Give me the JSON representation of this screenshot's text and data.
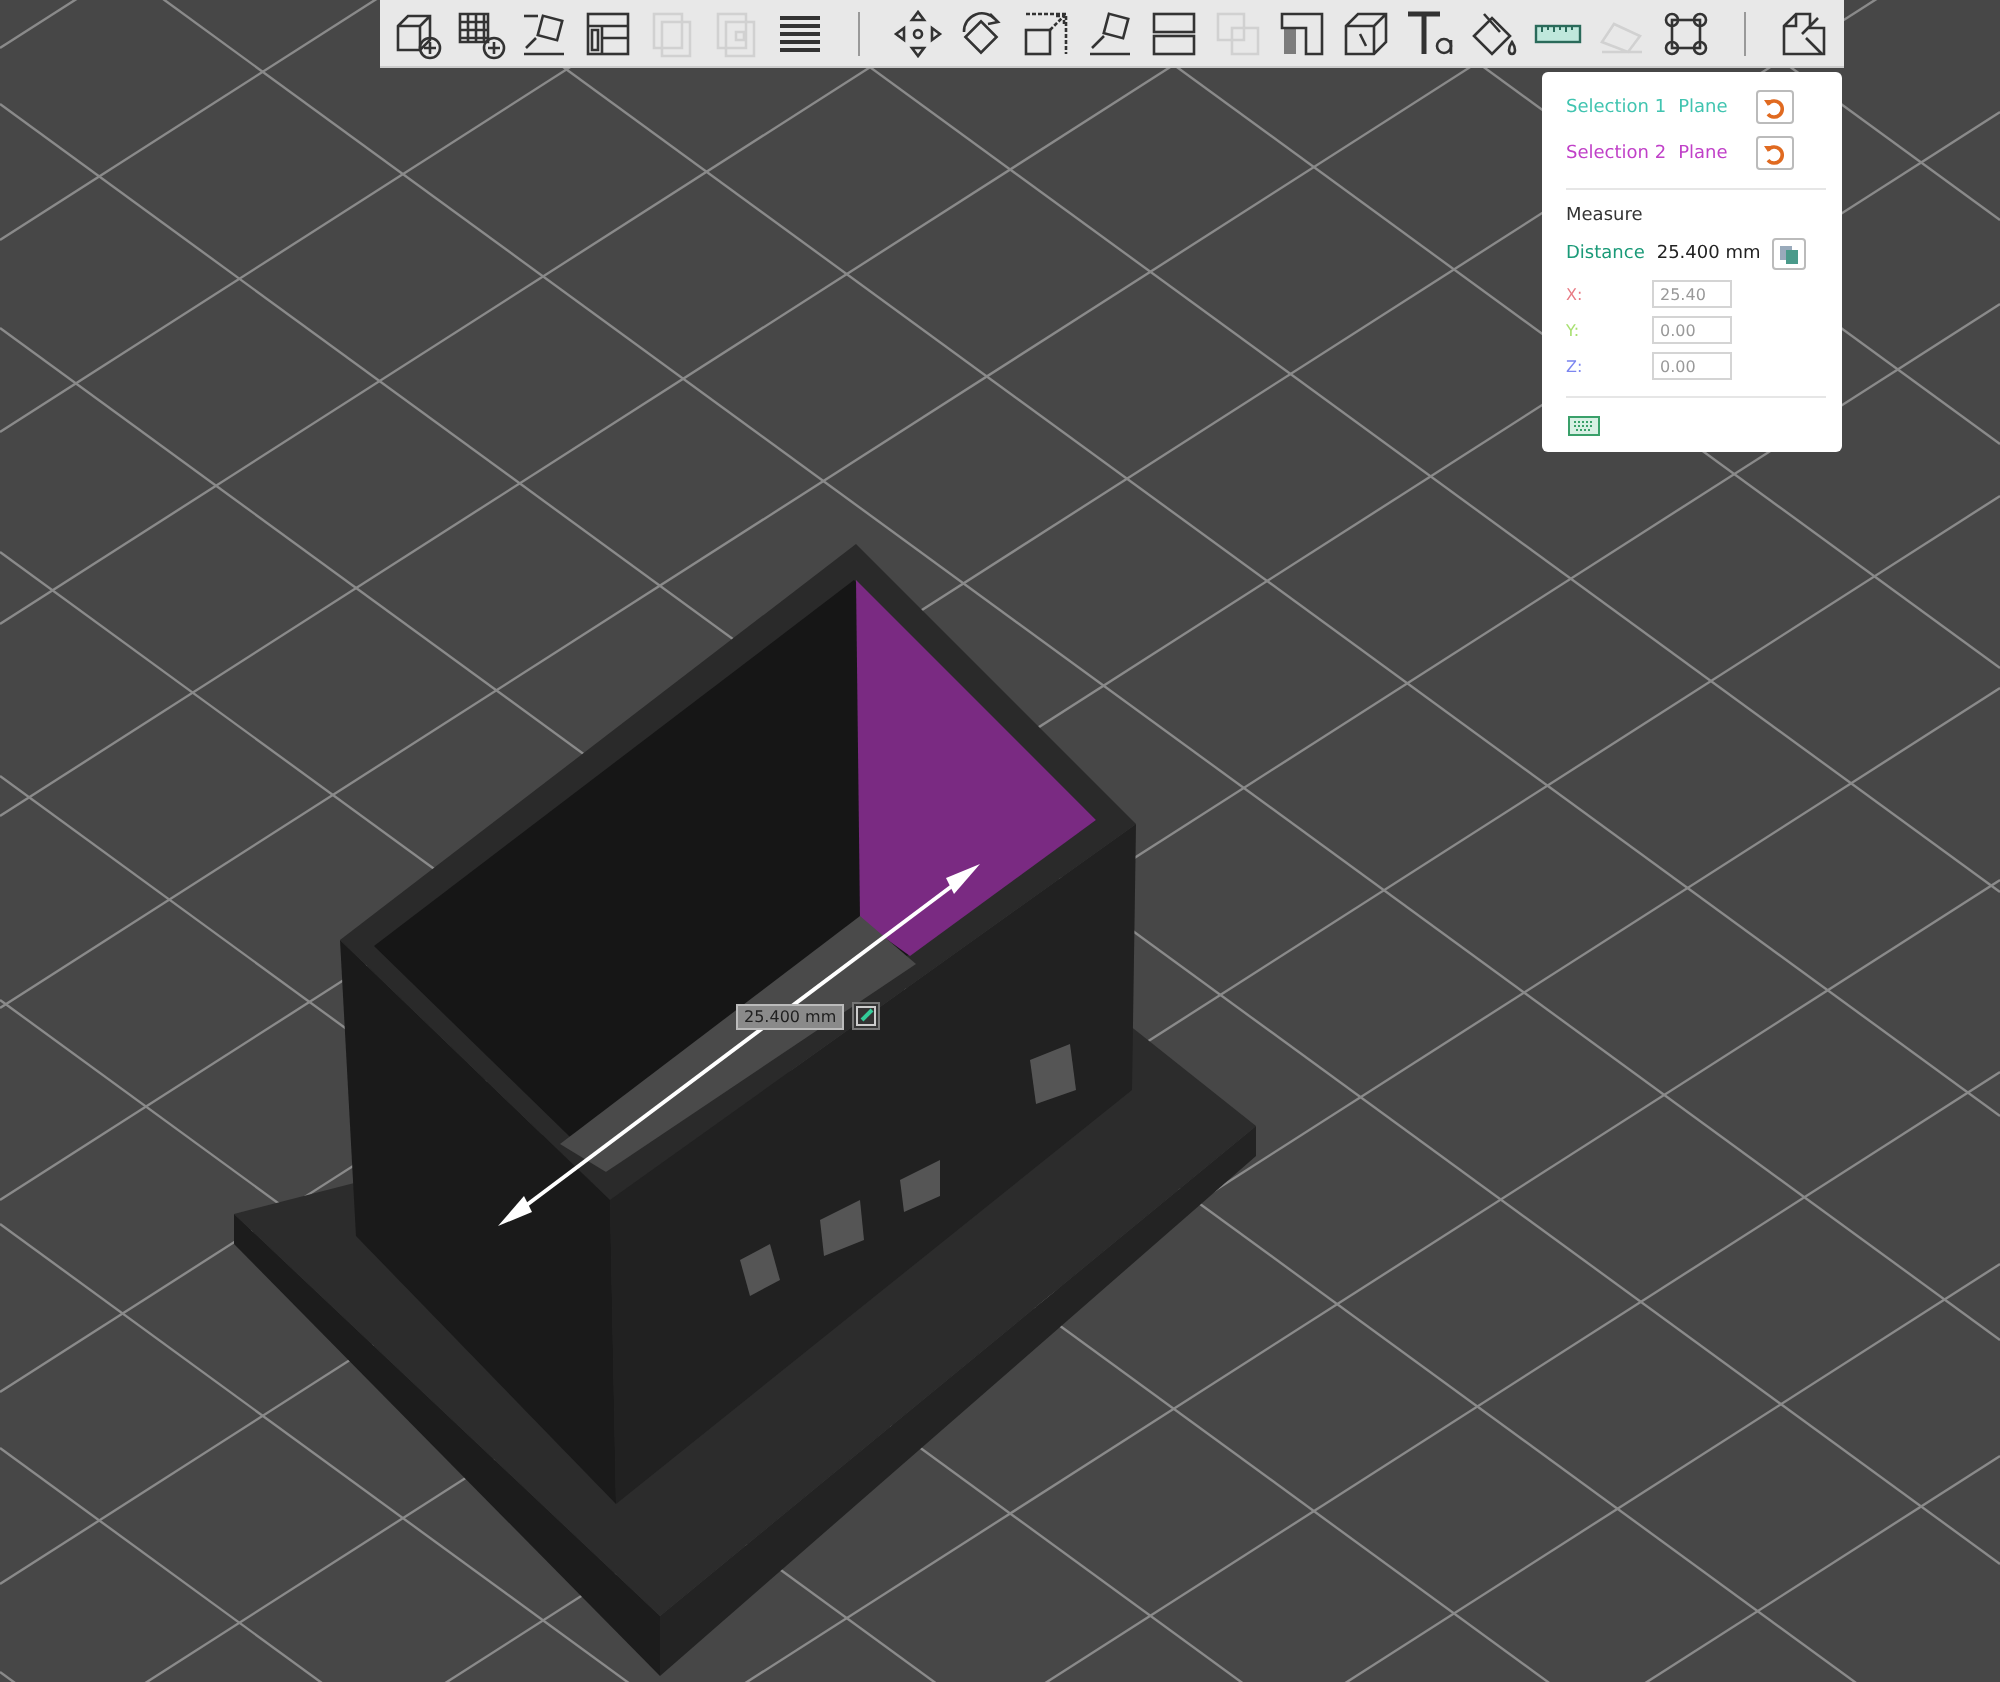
{
  "toolbar": {
    "tools": [
      {
        "kind": "add-cube",
        "disabled": false
      },
      {
        "kind": "add-plate",
        "disabled": false
      },
      {
        "kind": "auto-orient",
        "disabled": false
      },
      {
        "kind": "arrange",
        "disabled": false
      },
      {
        "kind": "copy",
        "disabled": true
      },
      {
        "kind": "paste",
        "disabled": true
      },
      {
        "kind": "layers",
        "disabled": false
      },
      {
        "kind": "separator"
      },
      {
        "kind": "move",
        "disabled": false
      },
      {
        "kind": "rotate",
        "disabled": false
      },
      {
        "kind": "scale",
        "disabled": false
      },
      {
        "kind": "lay-flat",
        "disabled": false
      },
      {
        "kind": "cut",
        "disabled": false
      },
      {
        "kind": "boolean",
        "disabled": true
      },
      {
        "kind": "support",
        "disabled": false
      },
      {
        "kind": "seam",
        "disabled": false
      },
      {
        "kind": "text",
        "disabled": false
      },
      {
        "kind": "paint",
        "disabled": false
      },
      {
        "kind": "measure",
        "disabled": false
      },
      {
        "kind": "assembly",
        "disabled": true
      },
      {
        "kind": "brim",
        "disabled": false
      },
      {
        "kind": "separator"
      },
      {
        "kind": "split",
        "disabled": false
      }
    ]
  },
  "measure_panel": {
    "selections": [
      {
        "label": "Selection 1",
        "value": "Plane",
        "color": "#40c4b0"
      },
      {
        "label": "Selection 2",
        "value": "Plane",
        "color": "#c040c8"
      }
    ],
    "title": "Measure",
    "distance": {
      "label": "Distance",
      "value": "25.400 mm"
    },
    "axes": [
      {
        "label": "X:",
        "value": "25.40",
        "color": "#e87a84"
      },
      {
        "label": "Y:",
        "value": "0.00",
        "color": "#a8e070"
      },
      {
        "label": "Z:",
        "value": "0.00",
        "color": "#7c86f0"
      }
    ]
  },
  "viewport": {
    "dimension_label": "25.400 mm"
  }
}
